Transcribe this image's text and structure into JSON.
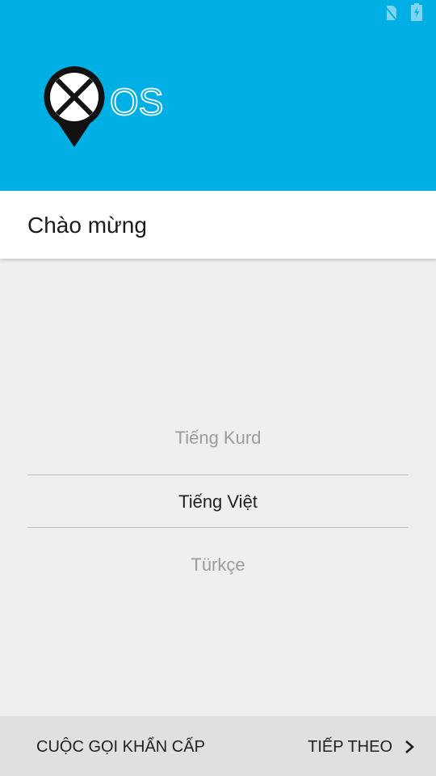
{
  "colors": {
    "header_background": "#00afe3",
    "title_bar_background": "#ffffff",
    "body_background": "#efefef",
    "bottom_bar_background": "#e0e0e0"
  },
  "status_bar": {
    "icons": [
      "no-sim-icon",
      "battery-charging-icon"
    ]
  },
  "logo": {
    "text": "OS",
    "icon": "x-marker-logo"
  },
  "header": {
    "title": "Chào mừng"
  },
  "language_picker": {
    "previous": "Tiếng Kurd",
    "selected": "Tiếng Việt",
    "next": "Türkçe"
  },
  "footer": {
    "emergency_label": "CUỘC GỌI KHẨN CẤP",
    "next_label": "TIẾP THEO",
    "next_icon": "chevron-right-icon"
  }
}
